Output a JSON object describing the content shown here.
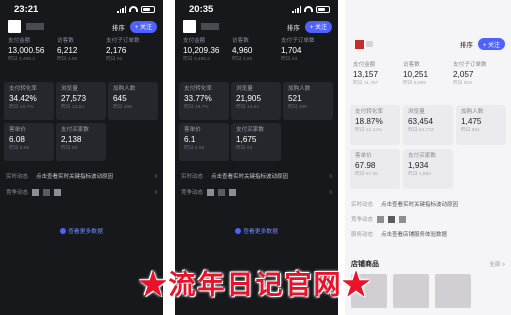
{
  "banner_text": "★流年日记官网★",
  "phones": [
    {
      "time": "23:21",
      "sort_label": "排序",
      "follow_label": "+ 关注",
      "top_metrics": [
        {
          "label": "支付金额",
          "value": "13,000.56",
          "sub": "昨日 3,465.2"
        },
        {
          "label": "访客数",
          "value": "6,212",
          "sub": "昨日 3,90"
        },
        {
          "label": "支付子订单数",
          "value": "2,176",
          "sub": "昨日 93"
        }
      ],
      "cards": [
        {
          "label": "支付转化率",
          "value": "34.42%",
          "sub": "昨日 28.7%"
        },
        {
          "label": "浏览量",
          "value": "27,573",
          "sub": "昨日 13,54"
        },
        {
          "label": "加购人数",
          "value": "645",
          "sub": "昨日 306"
        },
        {
          "label": "客单价",
          "value": "6.08",
          "sub": "昨日 5.96"
        },
        {
          "label": "支付买家数",
          "value": "2,138",
          "sub": "昨日 93"
        }
      ],
      "insight_label": "实时动态",
      "insight_text": "点击查看实时关键指标波动原因",
      "competitor_label": "竞争动态",
      "more_label": "查看更多数据"
    },
    {
      "time": "20:35",
      "sort_label": "排序",
      "follow_label": "+ 关注",
      "top_metrics": [
        {
          "label": "支付金额",
          "value": "10,209.36",
          "sub": "昨日 3,465.2"
        },
        {
          "label": "访客数",
          "value": "4,960",
          "sub": "昨日 3,90"
        },
        {
          "label": "支付子订单数",
          "value": "1,704",
          "sub": "昨日 93"
        }
      ],
      "cards": [
        {
          "label": "支付转化率",
          "value": "33.77%",
          "sub": "昨日 28.7%"
        },
        {
          "label": "浏览量",
          "value": "21,905",
          "sub": "昨日 13,54"
        },
        {
          "label": "加购人数",
          "value": "521",
          "sub": "昨日 306"
        },
        {
          "label": "客单价",
          "value": "6.1",
          "sub": "昨日 5.96"
        },
        {
          "label": "支付买家数",
          "value": "1,675",
          "sub": "昨日 93"
        }
      ],
      "insight_label": "实时动态",
      "insight_text": "点击查看实时关键指标波动原因",
      "competitor_label": "竞争动态",
      "more_label": "查看更多数据"
    },
    {
      "sort_label": "排序",
      "follow_label": "+ 关注",
      "top_metrics": [
        {
          "label": "支付金额",
          "value": "13,157",
          "sub": "昨日 11,757"
        },
        {
          "label": "访客数",
          "value": "10,251",
          "sub": "昨日 8,909"
        },
        {
          "label": "支付子订单数",
          "value": "2,057",
          "sub": "昨日 910"
        }
      ],
      "cards": [
        {
          "label": "支付转化率",
          "value": "18.87%",
          "sub": "昨日 21.12%"
        },
        {
          "label": "浏览量",
          "value": "63,454",
          "sub": "昨日 54,723"
        },
        {
          "label": "加购人数",
          "value": "1,475",
          "sub": "昨日 861"
        },
        {
          "label": "客单价",
          "value": "67.98",
          "sub": "昨日 67.35"
        },
        {
          "label": "支付买家数",
          "value": "1,934",
          "sub": "昨日 1,882"
        }
      ],
      "insight_label": "实时动态",
      "insight_text": "点击查看实时关键指标波动原因",
      "competitor_label": "竞争动态",
      "service_label": "服务动态",
      "service_text": "点击查看店铺服务体验数据",
      "shop_label": "店铺商品",
      "shop_all": "全部 >"
    }
  ]
}
